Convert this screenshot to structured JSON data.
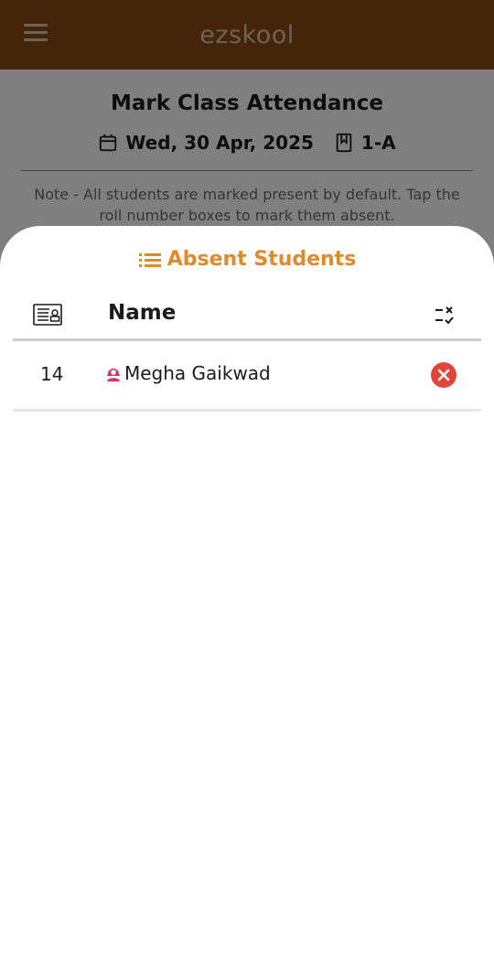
{
  "appbar": {
    "title": "ezskool",
    "menu_icon": "menu-icon"
  },
  "page": {
    "title": "Mark Class Attendance",
    "date": "Wed, 30 Apr, 2025",
    "class": "1-A",
    "note": "Note - All students are marked present by default. Tap the roll number boxes to mark them absent."
  },
  "sheet": {
    "title": "Absent Students",
    "headers": {
      "name": "Name"
    },
    "rows": [
      {
        "roll": "14",
        "name": "Megha Gaikwad"
      }
    ]
  },
  "colors": {
    "appbar": "#8b4a10",
    "accent": "#e08a2c",
    "remove": "#e1453a"
  }
}
